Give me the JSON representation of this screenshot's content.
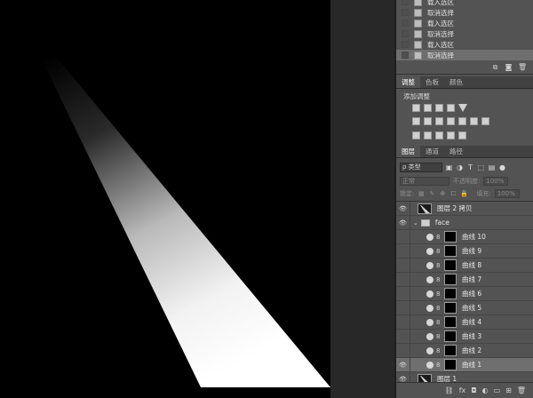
{
  "history": {
    "items": [
      {
        "label": "载入选区",
        "partial": true
      },
      {
        "label": "取消选择"
      },
      {
        "label": "载入选区"
      },
      {
        "label": "取消选择"
      },
      {
        "label": "载入选区"
      },
      {
        "label": "取消选择",
        "selected": true
      }
    ],
    "footer_icons": [
      "new-document-from-state-icon",
      "camera-icon",
      "trash-icon"
    ]
  },
  "adjustments_panel": {
    "tabs": [
      {
        "label": "调整",
        "active": true
      },
      {
        "label": "色板"
      },
      {
        "label": "颜色"
      }
    ],
    "title": "添加调整",
    "icon_rows": [
      [
        "brightness-icon",
        "levels-icon",
        "curves-icon",
        "exposure-icon",
        "gradient-triangle-icon"
      ],
      [
        "vibrance-icon",
        "hue-saturation-icon",
        "color-balance-icon",
        "black-white-icon",
        "photo-filter-icon",
        "channel-mixer-icon",
        "color-lookup-icon"
      ],
      [
        "invert-icon",
        "posterize-icon",
        "threshold-icon",
        "gradient-map-icon",
        "selective-color-icon"
      ]
    ]
  },
  "layers_panel": {
    "tabs": [
      {
        "label": "图层",
        "active": true
      },
      {
        "label": "通道"
      },
      {
        "label": "路径"
      }
    ],
    "filter": {
      "label": "ρ 类型"
    },
    "blend_mode": "正常",
    "opacity_label": "不透明度:",
    "opacity_value": "100%",
    "lock_label": "锁定:",
    "fill_label": "填充:",
    "fill_value": "100%",
    "layers": [
      {
        "name": "图层 2 拷贝",
        "type": "pixel",
        "visible": true
      },
      {
        "name": "face",
        "type": "group",
        "visible": true
      },
      {
        "name": "曲线 10",
        "type": "adjustment"
      },
      {
        "name": "曲线 9",
        "type": "adjustment"
      },
      {
        "name": "曲线 8",
        "type": "adjustment"
      },
      {
        "name": "曲线 7",
        "type": "adjustment"
      },
      {
        "name": "曲线 6",
        "type": "adjustment"
      },
      {
        "name": "曲线 5",
        "type": "adjustment"
      },
      {
        "name": "曲线 4",
        "type": "adjustment"
      },
      {
        "name": "曲线 3",
        "type": "adjustment"
      },
      {
        "name": "曲线 2",
        "type": "adjustment"
      },
      {
        "name": "曲线 1",
        "type": "adjustment",
        "visible": true,
        "selected": true
      },
      {
        "name": "图层 1",
        "type": "pixel",
        "visible": true
      }
    ],
    "footer_icons": [
      "link-icon",
      "fx-icon",
      "mask-icon",
      "adjustment-icon",
      "folder-icon",
      "new-layer-icon",
      "trash-icon"
    ],
    "footer_fx": "fx"
  }
}
